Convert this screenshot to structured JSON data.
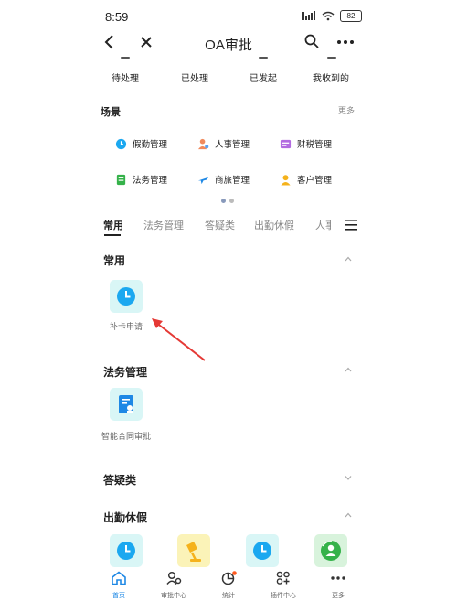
{
  "status": {
    "time": "8:59",
    "battery": "82"
  },
  "nav": {
    "title": "OA审批"
  },
  "stats": [
    "待处理",
    "已处理",
    "已发起",
    "我收到的"
  ],
  "scenes": {
    "title": "场景",
    "more": "更多",
    "items": [
      "假勤管理",
      "人事管理",
      "财税管理",
      "法务管理",
      "商旅管理",
      "客户管理"
    ]
  },
  "categories": [
    "常用",
    "法务管理",
    "答疑类",
    "出勤休假",
    "人事"
  ],
  "groups": [
    {
      "title": "常用",
      "apps": [
        "补卡申请"
      ]
    },
    {
      "title": "法务管理",
      "apps": [
        "智能合同审批"
      ]
    },
    {
      "title": "答疑类"
    },
    {
      "title": "出勤休假"
    }
  ],
  "bottom_nav": [
    "首页",
    "审批中心",
    "统计",
    "插件中心",
    "更多"
  ],
  "colors": {
    "accent": "#1e88e5",
    "tile_bg": "#d9f6f6",
    "clock_blue": "#1ba8f0",
    "arrow_red": "#e53935"
  }
}
